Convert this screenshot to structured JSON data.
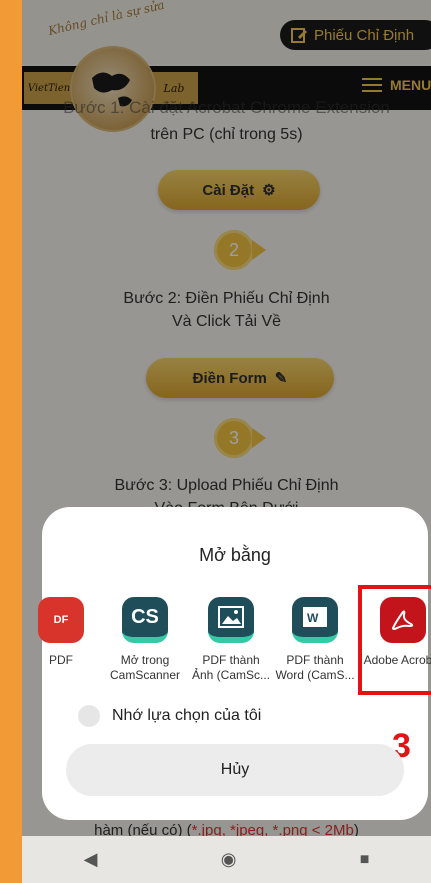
{
  "header": {
    "slogan": "Không chỉ là sự sửa",
    "phieu_btn": "Phiếu Chỉ Định",
    "brand_left": "VietTien",
    "brand_right": "Lab",
    "menu": "MENU"
  },
  "page": {
    "step1_cut": "Bước 1: Cài đặt Acrobat Chrome Extension",
    "step1_sub": "trên PC (chỉ trong 5s)",
    "install_btn": "Cài Đặt",
    "step2_num": "2",
    "step2_title_1": "Bước 2: Điền Phiếu Chỉ Định",
    "step2_title_2": "Và Click Tải Về",
    "fill_btn": "Điền Form",
    "step3_num": "3",
    "step3_title_1": "Bước 3: Upload Phiếu Chỉ Định",
    "step3_title_2": "Vào Form Bên Dưới",
    "bottom_text_pre": "hàm (nếu có) (",
    "bottom_text_link": "*.jpg, *jpeg, *.png < 2Mb",
    "bottom_text_post": ")"
  },
  "dialog": {
    "title": "Mở bằng",
    "apps": [
      {
        "label": "PDF",
        "icon": "pdf-icon"
      },
      {
        "label": "Mở trong CamScanner",
        "icon": "camscanner-icon"
      },
      {
        "label": "PDF thành Ảnh (CamSc...",
        "icon": "image-icon"
      },
      {
        "label": "PDF thành Word (CamS...",
        "icon": "word-icon"
      },
      {
        "label": "Adobe Acrobat",
        "icon": "acrobat-icon"
      }
    ],
    "remember": "Nhớ lựa chọn của tôi",
    "cancel": "Hủy",
    "annotation": "3"
  },
  "colors": {
    "frame": "#f29a35",
    "gold": "#efc13f",
    "highlight": "#e31313"
  }
}
